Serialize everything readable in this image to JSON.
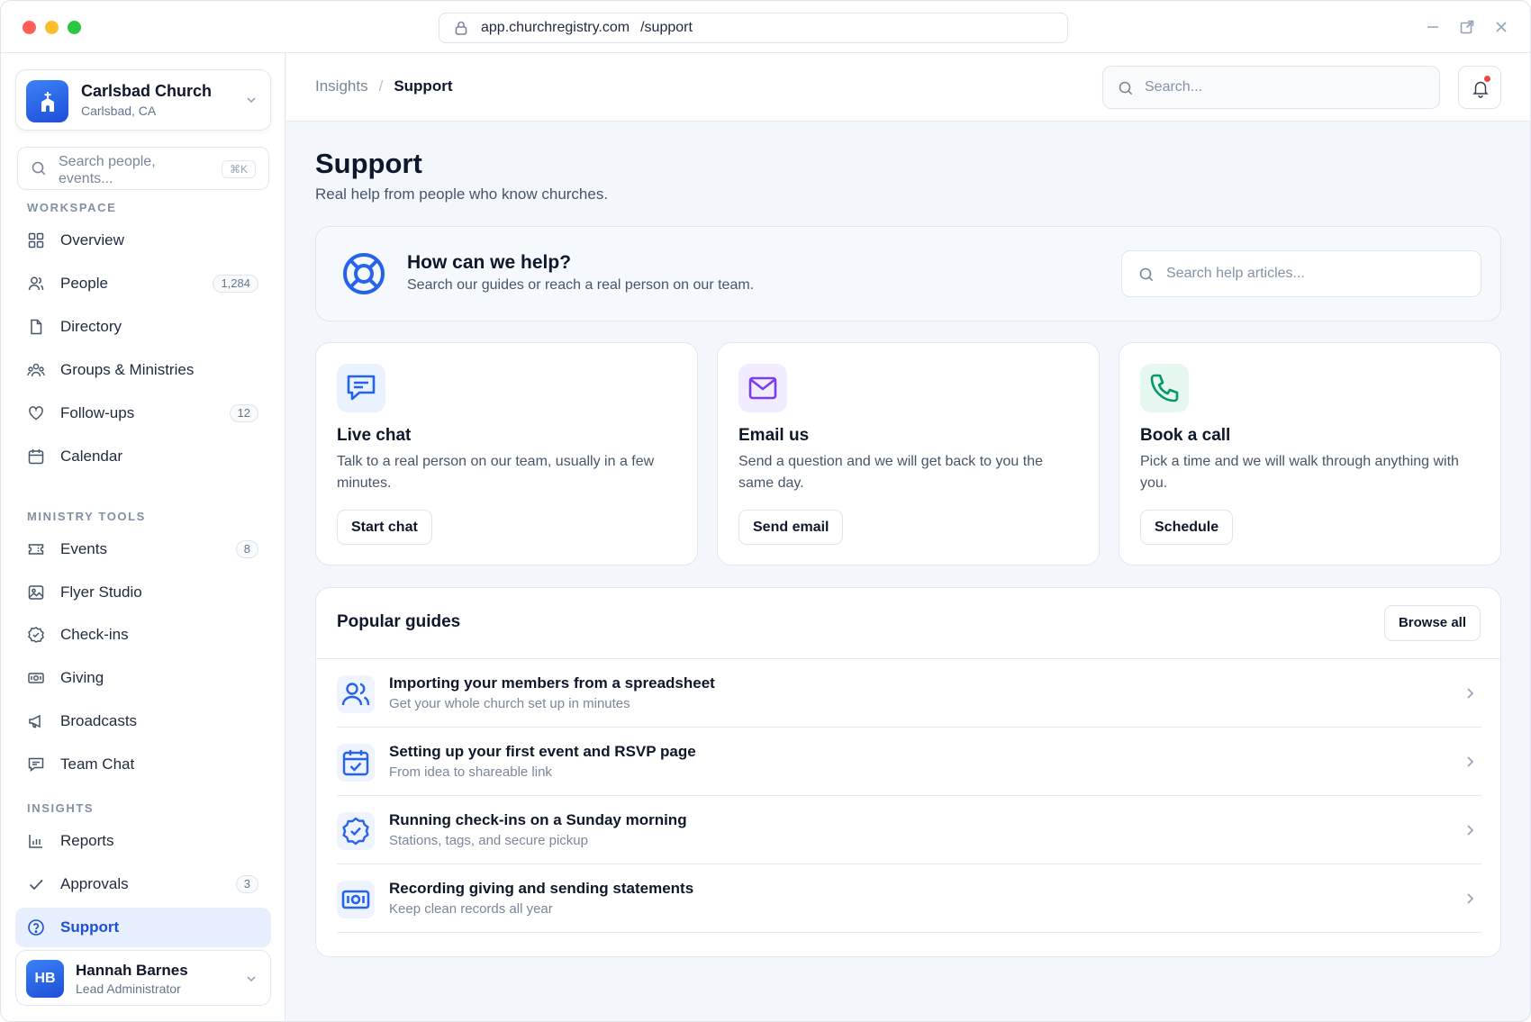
{
  "browser": {
    "url_domain": "app.churchregistry.com",
    "url_path": "/support",
    "colors": {
      "close": "#ff5f57",
      "minimize": "#febc2e",
      "maximize": "#28c840"
    }
  },
  "sidebar": {
    "org": {
      "name": "Carlsbad Church",
      "location": "Carlsbad, CA",
      "icon": "church-icon"
    },
    "search": {
      "placeholder": "Search people, events...",
      "shortcut": "⌘K"
    },
    "sections": [
      {
        "label": "WORKSPACE"
      },
      {
        "label": "MINISTRY TOOLS"
      },
      {
        "label": "INSIGHTS"
      }
    ],
    "items": [
      {
        "label": "Overview",
        "icon": "grid-icon"
      },
      {
        "label": "People",
        "icon": "people-icon",
        "badge": "1,284"
      },
      {
        "label": "Directory",
        "icon": "document-icon"
      },
      {
        "label": "Groups & Ministries",
        "icon": "groups-icon"
      },
      {
        "label": "Follow-ups",
        "icon": "heart-icon",
        "badge": "12"
      },
      {
        "label": "Calendar",
        "icon": "calendar-icon"
      },
      {
        "label": "Events",
        "icon": "ticket-icon",
        "badge": "8"
      },
      {
        "label": "Flyer Studio",
        "icon": "image-icon"
      },
      {
        "label": "Check-ins",
        "icon": "badge-check-icon"
      },
      {
        "label": "Giving",
        "icon": "banknote-icon"
      },
      {
        "label": "Broadcasts",
        "icon": "megaphone-icon"
      },
      {
        "label": "Team Chat",
        "icon": "chat-icon"
      },
      {
        "label": "Reports",
        "icon": "bar-chart-icon"
      },
      {
        "label": "Approvals",
        "icon": "check-icon",
        "badge": "3"
      },
      {
        "label": "Support",
        "icon": "help-circle-icon",
        "active": true
      }
    ],
    "user": {
      "initials": "HB",
      "name": "Hannah Barnes",
      "role": "Lead Administrator"
    }
  },
  "header": {
    "breadcrumb": {
      "parent": "Insights",
      "separator": "/",
      "current": "Support"
    },
    "search_placeholder": "Search...",
    "bell_icon": "bell-icon"
  },
  "page": {
    "title": "Support",
    "subtitle": "Real help from people who know churches.",
    "help": {
      "title": "How can we help?",
      "subtitle": "Search our guides or reach a real person on our team.",
      "search_placeholder": "Search help articles..."
    },
    "contact_options": [
      {
        "title": "Live chat",
        "description": "Talk to a real person on our team, usually in a few minutes.",
        "button": "Start chat",
        "icon": "chat-bubble-icon",
        "color": "#2563eb",
        "bg": "#eaf1ff"
      },
      {
        "title": "Email us",
        "description": "Send a question and we will get back to you the same day.",
        "button": "Send email",
        "icon": "mail-icon",
        "color": "#7c3aed",
        "bg": "#f1ecff"
      },
      {
        "title": "Book a call",
        "description": "Pick a time and we will walk through anything with you.",
        "button": "Schedule",
        "icon": "phone-icon",
        "color": "#059669",
        "bg": "#e6f7ef"
      }
    ],
    "guides": {
      "title": "Popular guides",
      "browse_label": "Browse all",
      "items": [
        {
          "title": "Importing your members from a spreadsheet",
          "subtitle": "Get your whole church set up in minutes",
          "icon": "users-icon"
        },
        {
          "title": "Setting up your first event and RSVP page",
          "subtitle": "From idea to shareable link",
          "icon": "calendar-check-icon"
        },
        {
          "title": "Running check-ins on a Sunday morning",
          "subtitle": "Stations, tags, and secure pickup",
          "icon": "badge-check-icon"
        },
        {
          "title": "Recording giving and sending statements",
          "subtitle": "Keep clean records all year",
          "icon": "banknote-icon"
        }
      ]
    }
  }
}
